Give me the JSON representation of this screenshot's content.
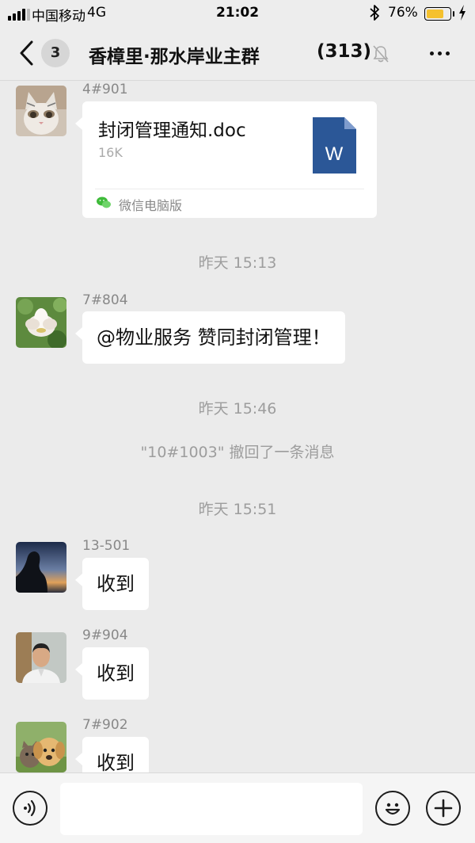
{
  "status_bar": {
    "carrier": "中国移动",
    "network": "4G",
    "time": "21:02",
    "battery_percent": "76%",
    "battery_level": 0.76,
    "battery_color": "#f5c12e",
    "icons": [
      "signal-icon",
      "bluetooth-icon",
      "battery-icon",
      "charging-icon"
    ]
  },
  "nav": {
    "unread_count": "3",
    "title": "香樟里·那水岸业主群",
    "member_count": "(313)",
    "icons": [
      "back-icon",
      "mute-bell-icon",
      "more-icon"
    ]
  },
  "messages": [
    {
      "sender": "4#901",
      "avatar": "cat-avatar",
      "file": {
        "name": "封闭管理通知.doc",
        "size": "16K",
        "icon": "word-doc-icon",
        "icon_letter": "W",
        "icon_color": "#2b5797",
        "source": "微信电脑版",
        "source_icon": "wechat-icon"
      }
    },
    {
      "timestamp": "昨天 15:13"
    },
    {
      "sender": "7#804",
      "avatar": "lotus-avatar",
      "text": "@物业服务 赞同封闭管理！"
    },
    {
      "timestamp": "昨天 15:46"
    },
    {
      "recall": "\"10#1003\" 撤回了一条消息"
    },
    {
      "timestamp": "昨天 15:51"
    },
    {
      "sender": "13-501",
      "avatar": "silhouette-avatar",
      "text": "收到"
    },
    {
      "sender": "9#904",
      "avatar": "man-avatar",
      "text": "收到"
    },
    {
      "sender": "7#902",
      "avatar": "puppy-kitten-avatar",
      "text": "收到"
    }
  ],
  "input_bar": {
    "icons": [
      "voice-icon",
      "emoji-icon",
      "plus-icon"
    ],
    "input_value": ""
  }
}
